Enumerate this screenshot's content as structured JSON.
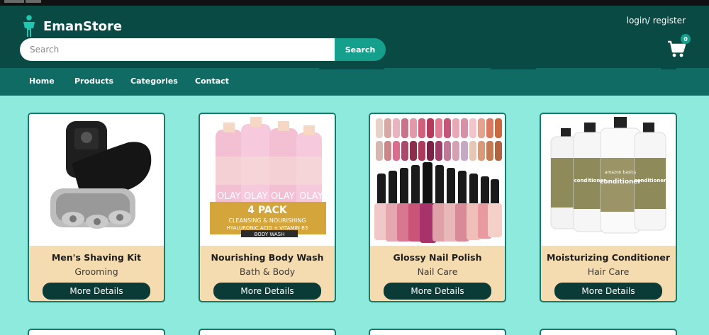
{
  "brand": {
    "name": "EmanStore"
  },
  "auth": {
    "login": "login/",
    "register": "register"
  },
  "search": {
    "placeholder": "Search",
    "button_label": "Search"
  },
  "cart": {
    "count": "0",
    "icon": "cart-icon"
  },
  "nav": {
    "items": [
      {
        "label": "Home"
      },
      {
        "label": "Products"
      },
      {
        "label": "Categories"
      },
      {
        "label": "Contact"
      }
    ]
  },
  "products": [
    {
      "title": "Men's Shaving Kit",
      "category": "Grooming",
      "button": "More Details",
      "image": "electric-shaver"
    },
    {
      "title": "Nourishing Body Wash",
      "category": "Bath & Body",
      "button": "More Details",
      "image": "body-wash-bottles",
      "image_text": {
        "brand": "OLAY",
        "line1": "4 PACK",
        "line2": "CLEANSING & NOURISHING",
        "line3": "HYALURONIC ACID + VITAMIN B3",
        "line4": "BODY WASH"
      }
    },
    {
      "title": "Glossy Nail Polish",
      "category": "Nail Care",
      "button": "More Details",
      "image": "nail-polish-set"
    },
    {
      "title": "Moisturizing Conditioner",
      "category": "Hair Care",
      "button": "More Details",
      "image": "conditioner-bottles",
      "image_text": {
        "brand": "amazon basics",
        "line1": "conditioner"
      }
    }
  ],
  "colors": {
    "page_bg": "#8eeadc",
    "header_bg": "#0a4a45",
    "nav_bg": "#0f6b64",
    "accent": "#14a08d",
    "card_bg": "#f4dcb0",
    "button_dark": "#0a3b36"
  }
}
